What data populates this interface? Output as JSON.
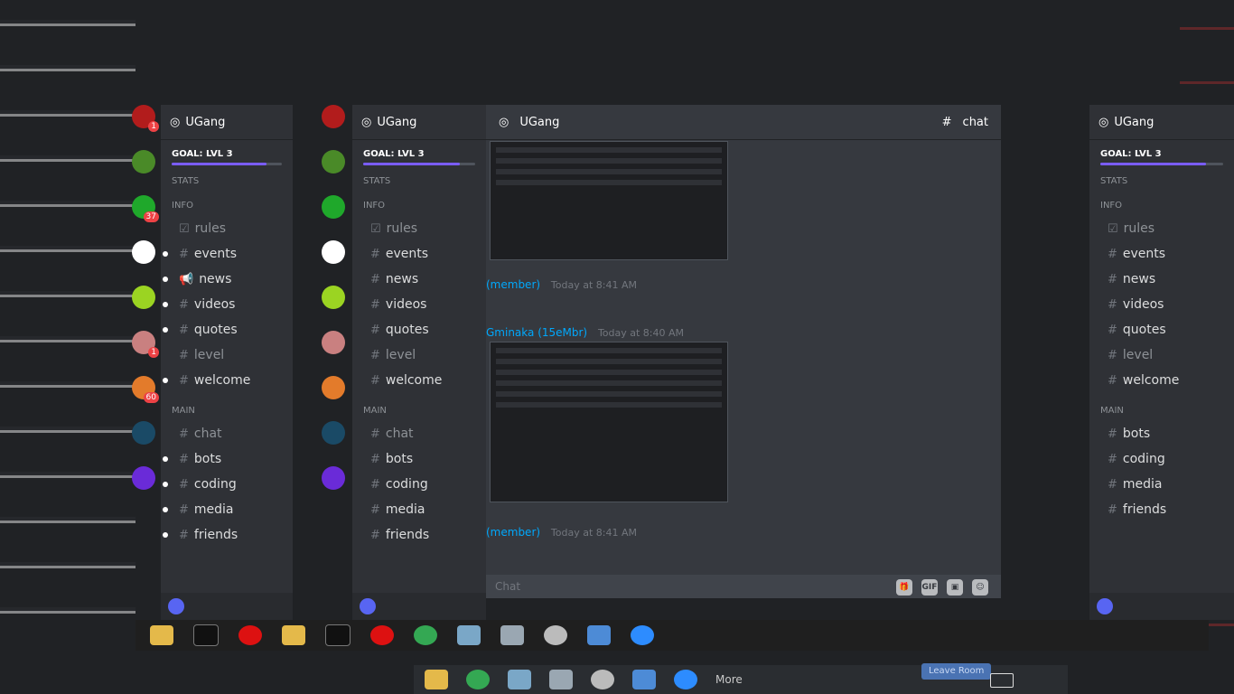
{
  "server_name": "UGang",
  "goal_label": "GOAL: LVL 3",
  "goal_progress": 0.86,
  "categories": {
    "stats": "STATS",
    "info": "INFO",
    "main": "MAIN"
  },
  "channels": {
    "rules": "rules",
    "events": "events",
    "news": "news",
    "videos": "videos",
    "quotes": "quotes",
    "level": "level",
    "welcome": "welcome",
    "chat": "chat",
    "bots": "bots",
    "coding": "coding",
    "media": "media",
    "friends": "friends"
  },
  "server_badges": [
    "1",
    "37",
    "1",
    "60"
  ],
  "chat": {
    "channel": "chat",
    "author_1": "(member)",
    "time_1": "Today at 8:41 AM",
    "author_2": "Gminaka (15eMbr)",
    "time_2": "Today at 8:40 AM",
    "author_3": "(member)",
    "time_3": "Today at 8:41 AM",
    "input_placeholder": "Chat",
    "gif_label": "GIF"
  },
  "taskbar": {
    "more": "More",
    "leave_room": "Leave Room"
  },
  "icons": {
    "discord": "discord-icon",
    "opera": "opera-icon",
    "chrome": "chrome-icon",
    "zoom": "zoom-icon",
    "terminal": "terminal-icon",
    "folder": "folder-icon"
  }
}
